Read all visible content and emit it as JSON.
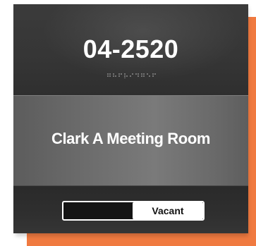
{
  "sign": {
    "room_number": "04-2520",
    "room_name": "Clark A Meeting Room",
    "status": {
      "label": "Vacant",
      "position": "right"
    },
    "colors": {
      "accent": "#f07a40",
      "panel_dark": "#2f2f2f",
      "panel_mid": "#6e6e6e",
      "text": "#ffffff"
    },
    "braille_icon": "braille-dots-icon"
  }
}
